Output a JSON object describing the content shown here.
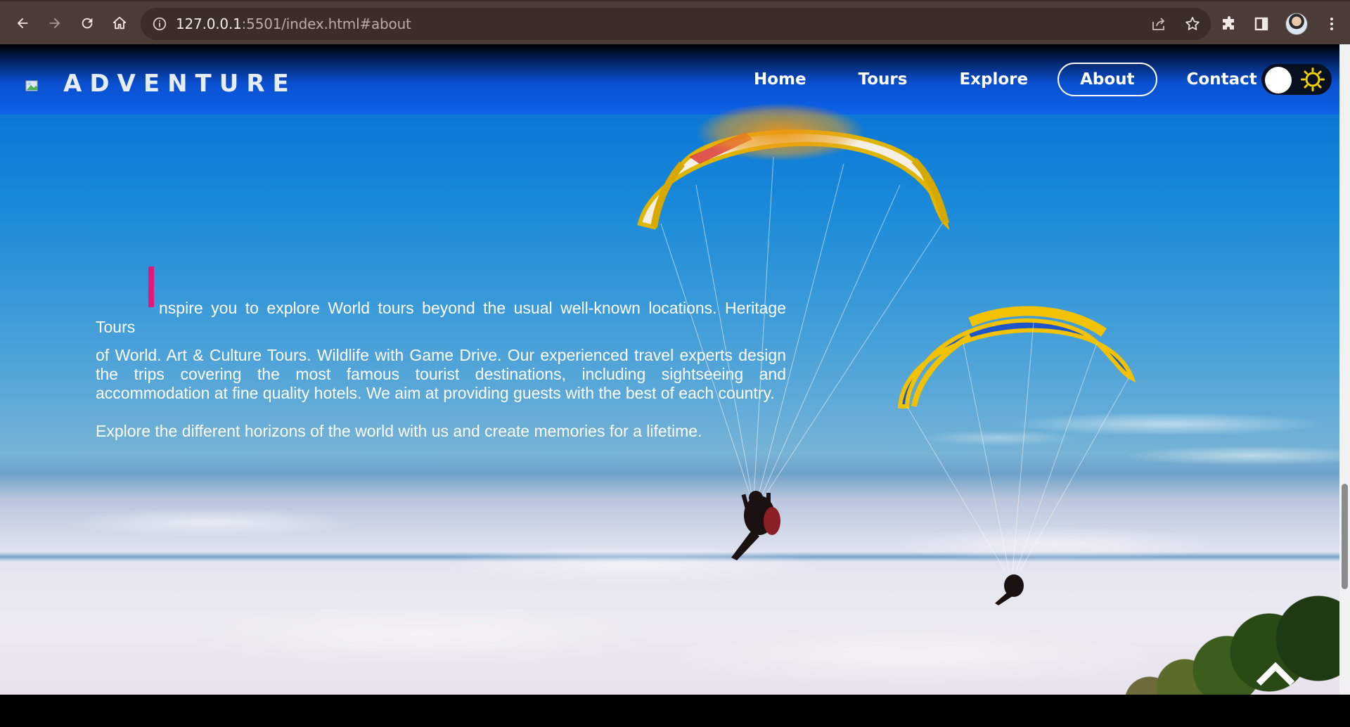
{
  "browser": {
    "url_host": "127.0.0.1",
    "url_rest": ":5501/index.html#about"
  },
  "navbar": {
    "brand": "ADVENTURE",
    "links": [
      {
        "label": "Home"
      },
      {
        "label": "Tours"
      },
      {
        "label": "Explore"
      },
      {
        "label": "About"
      },
      {
        "label": "Contact"
      }
    ],
    "active": "About"
  },
  "about": {
    "first_letter": "I",
    "first_line": "nspire you to explore World tours beyond the usual well-known locations. Heritage Tours",
    "paragraph_rest": "of World. Art & Culture Tours. Wildlife with Game Drive. Our experienced travel experts design the trips covering the most famous tourist destinations, including sightseeing and accommodation at fine quality hotels. We aim at providing guests with the best of each country.",
    "paragraph_2": "Explore the different horizons of the world with us and create memories for a lifetime."
  },
  "icons": {
    "back": "arrow-left-icon",
    "forward": "arrow-right-icon",
    "reload": "reload-icon",
    "home": "home-icon",
    "info": "info-icon",
    "share": "share-icon",
    "bookmark": "star-icon",
    "extensions": "puzzle-icon",
    "side_panel": "side-panel-icon",
    "menu": "kebab-menu-icon",
    "theme": "sun-icon",
    "scroll_top": "chevron-up-icon"
  },
  "colors": {
    "accent_bar": "#e8157a",
    "nav_blue": "#0d63e6",
    "toggle_bg": "#08101f",
    "sun": "#f5d000"
  }
}
